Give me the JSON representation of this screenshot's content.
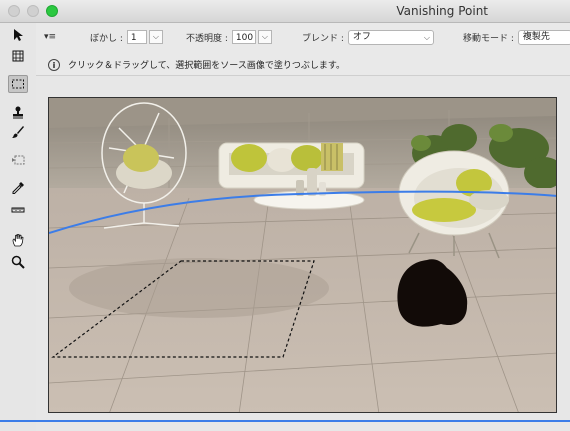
{
  "window": {
    "title": "Vanishing Point"
  },
  "options": {
    "menu_glyph": "▾≡",
    "blur": {
      "label": "ぼかし :",
      "value": "1"
    },
    "opacity": {
      "label": "不透明度 :",
      "value": "100"
    },
    "blend": {
      "label": "ブレンド :",
      "value": "オフ"
    },
    "move_mode": {
      "label": "移動モード :",
      "value": "複製先"
    }
  },
  "info": {
    "icon": "i",
    "text": "クリック＆ドラッグして、選択範囲をソース画像で塗りつぶします。"
  },
  "tools": [
    {
      "name": "edit-plane-tool-icon",
      "active": false
    },
    {
      "name": "create-plane-tool-icon",
      "active": false
    },
    {
      "name": "marquee-tool-icon",
      "active": true
    },
    {
      "name": "stamp-tool-icon",
      "active": false
    },
    {
      "name": "brush-tool-icon",
      "active": false
    },
    {
      "name": "transform-tool-icon",
      "active": false
    },
    {
      "name": "eyedropper-tool-icon",
      "active": false
    },
    {
      "name": "measure-tool-icon",
      "active": false
    },
    {
      "name": "hand-tool-icon",
      "active": false
    },
    {
      "name": "zoom-tool-icon",
      "active": false
    }
  ],
  "colors": {
    "plane_grid": "#3c7de8",
    "active_tool_bg": "#c6c6c6"
  }
}
